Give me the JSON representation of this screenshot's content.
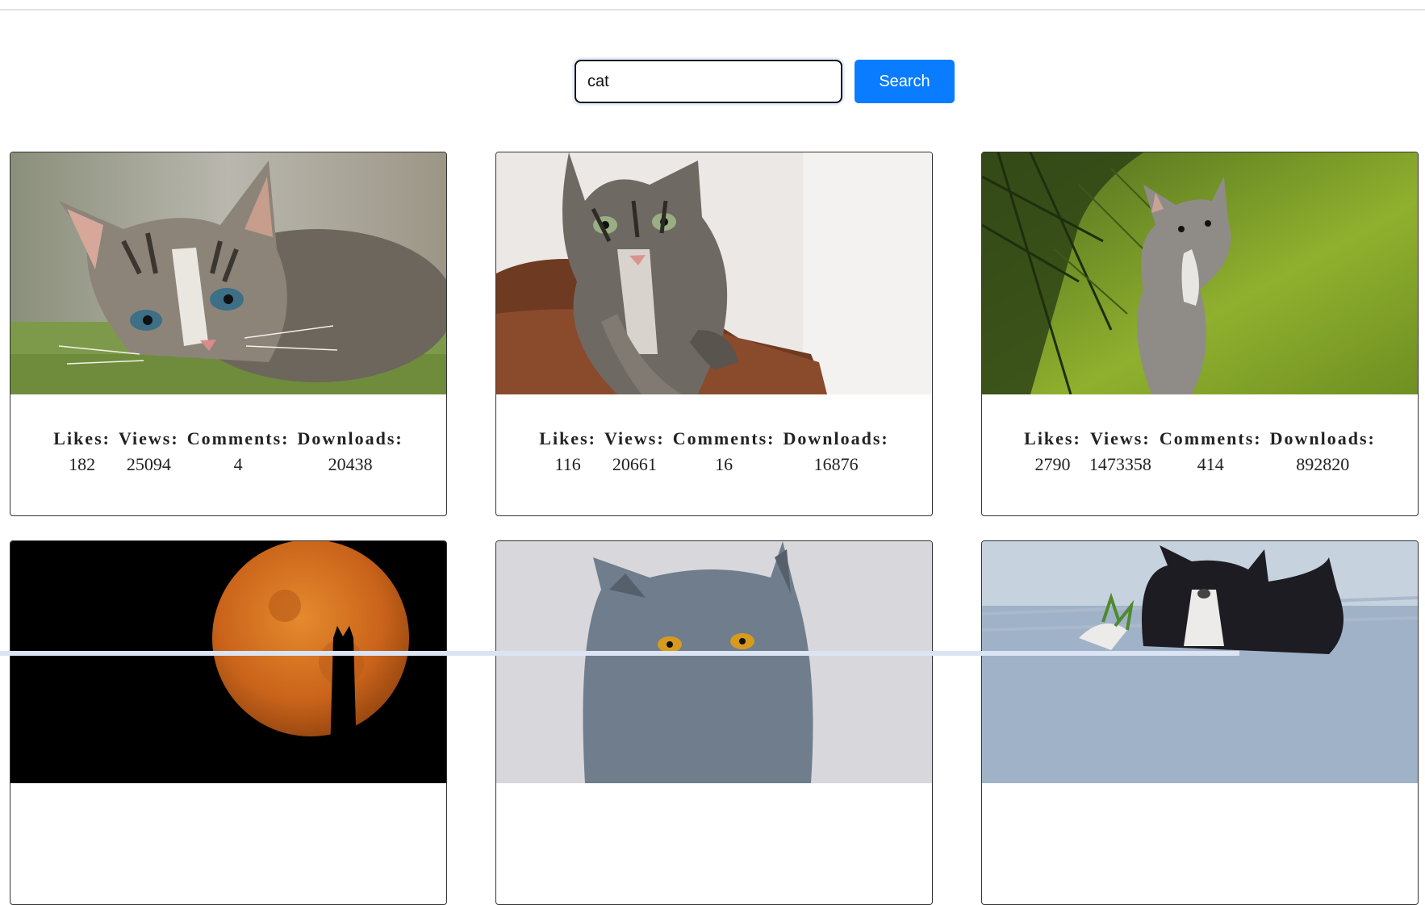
{
  "search": {
    "value": "cat",
    "button_label": "Search"
  },
  "stat_labels": {
    "likes": "Likes:",
    "views": "Views:",
    "comments": "Comments:",
    "downloads": "Downloads:"
  },
  "cards": [
    {
      "image": "tabby-kitten-lying-on-green-rug",
      "likes": "182",
      "views": "25094",
      "comments": "4",
      "downloads": "20438"
    },
    {
      "image": "tabby-cat-on-brown-cushion",
      "likes": "116",
      "views": "20661",
      "comments": "16",
      "downloads": "16876"
    },
    {
      "image": "grey-kitten-under-fir-branches",
      "likes": "2790",
      "views": "1473358",
      "comments": "414",
      "downloads": "892820"
    },
    {
      "image": "cat-silhouette-against-orange-moon"
    },
    {
      "image": "british-shorthair-grey-cat"
    },
    {
      "image": "black-and-white-kitten-playing"
    }
  ]
}
